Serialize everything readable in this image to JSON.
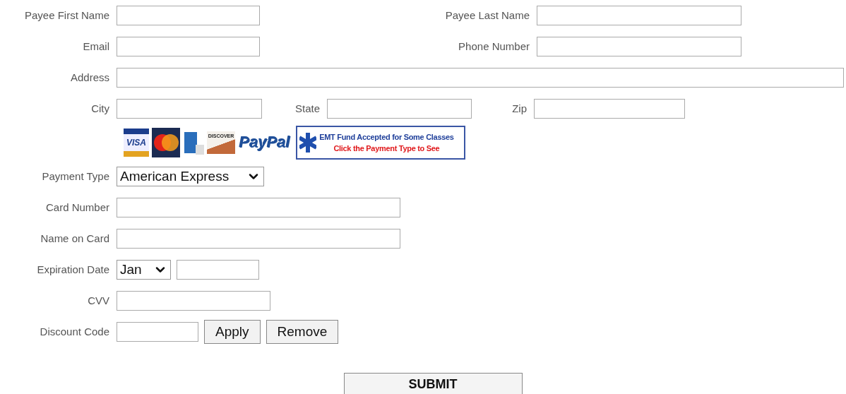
{
  "payee_first_name": {
    "label": "Payee First Name"
  },
  "payee_last_name": {
    "label": "Payee Last Name"
  },
  "email": {
    "label": "Email"
  },
  "phone_number": {
    "label": "Phone Number"
  },
  "address": {
    "label": "Address"
  },
  "city": {
    "label": "City"
  },
  "state": {
    "label": "State"
  },
  "zip": {
    "label": "Zip"
  },
  "card_logos": [
    {
      "kind": "visa",
      "text": "VISA"
    },
    {
      "kind": "mastercard"
    },
    {
      "kind": "amex"
    },
    {
      "kind": "discover",
      "text": "DISCOVER"
    },
    {
      "kind": "paypal",
      "text": "PayPal"
    }
  ],
  "emt_banner": {
    "title": "EMT Fund Accepted for Some Classes",
    "subtitle": "Click the Payment Type to See"
  },
  "payment_type": {
    "label": "Payment Type",
    "value": "American Express"
  },
  "card_number": {
    "label": "Card Number"
  },
  "name_on_card": {
    "label": "Name on Card"
  },
  "expiration_date": {
    "label": "Expiration Date",
    "month": "Jan"
  },
  "cvv": {
    "label": "CVV"
  },
  "discount_code": {
    "label": "Discount Code",
    "buttons": [
      "Apply",
      "Remove"
    ]
  },
  "submit": "SUBMIT"
}
